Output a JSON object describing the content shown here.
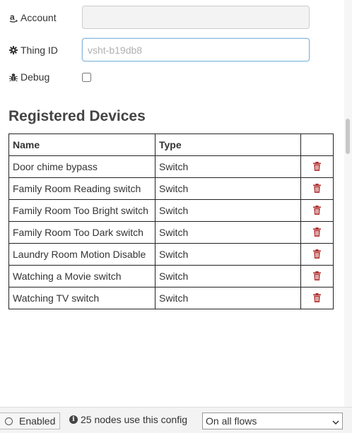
{
  "form": {
    "account": {
      "label": "Account",
      "value": "",
      "placeholder": ""
    },
    "thing_id": {
      "label": "Thing ID",
      "value": "",
      "placeholder": "vsht-b19db8"
    },
    "debug": {
      "label": "Debug",
      "checked": false
    }
  },
  "devices": {
    "title": "Registered Devices",
    "columns": [
      "Name",
      "Type",
      ""
    ],
    "rows": [
      {
        "name": "Door chime bypass",
        "type": "Switch"
      },
      {
        "name": "Family Room Reading switch",
        "type": "Switch"
      },
      {
        "name": "Family Room Too Bright switch",
        "type": "Switch"
      },
      {
        "name": "Family Room Too Dark switch",
        "type": "Switch"
      },
      {
        "name": "Laundry Room Motion Disable",
        "type": "Switch"
      },
      {
        "name": "Watching a Movie switch",
        "type": "Switch"
      },
      {
        "name": "Watching TV switch",
        "type": "Switch"
      }
    ],
    "delete_icon": "trash-icon"
  },
  "footer": {
    "enabled_label": "Enabled",
    "nodes_info": "25 nodes use this config",
    "scope_selected": "On all flows"
  },
  "colors": {
    "focus_border": "#85b7d9",
    "trash": "#b03030",
    "footer_bg": "#f3f3f3"
  }
}
